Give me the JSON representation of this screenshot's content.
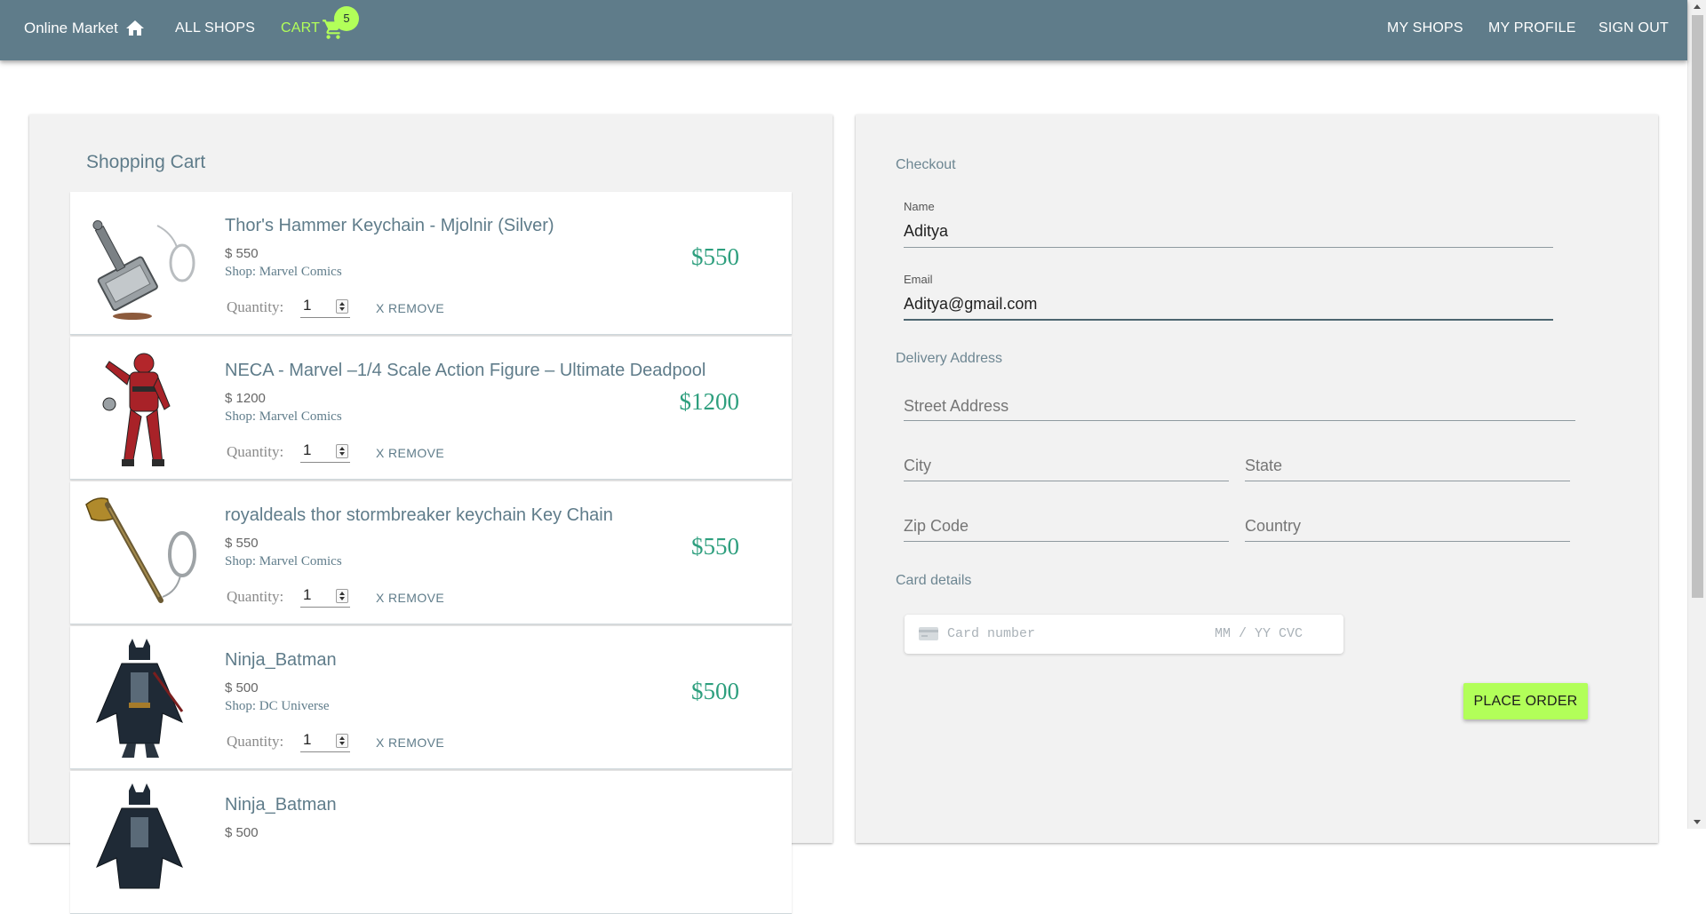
{
  "nav": {
    "brand": "Online Market",
    "all_shops": "ALL SHOPS",
    "cart": "CART",
    "cart_count": "5",
    "my_shops": "MY SHOPS",
    "my_profile": "MY PROFILE",
    "sign_out": "SIGN OUT",
    "icons": [
      "home-icon",
      "shopping-cart-icon"
    ],
    "colors": {
      "appbar": "#5f7c8a",
      "accent": "#b2ff59"
    }
  },
  "cart": {
    "title": "Shopping Cart",
    "quantity_label": "Quantity:",
    "remove_label": "X REMOVE",
    "items": [
      {
        "name": "Thor's Hammer Keychain - Mjolnir (Silver)",
        "unit_price": "$ 550",
        "shop": "Shop: Marvel Comics",
        "quantity": "1",
        "total": "$550",
        "image": "mjolnir-keychain"
      },
      {
        "name": "NECA - Marvel –1/4 Scale Action Figure – Ultimate Deadpool",
        "unit_price": "$ 1200",
        "shop": "Shop: Marvel Comics",
        "quantity": "1",
        "total": "$1200",
        "image": "deadpool-figure"
      },
      {
        "name": "royaldeals thor stormbreaker keychain Key Chain",
        "unit_price": "$ 550",
        "shop": "Shop: Marvel Comics",
        "quantity": "1",
        "total": "$550",
        "image": "stormbreaker-keychain"
      },
      {
        "name": "Ninja_Batman",
        "unit_price": "$ 500",
        "shop": "Shop: DC Universe",
        "quantity": "1",
        "total": "$500",
        "image": "ninja-batman"
      },
      {
        "name": "Ninja_Batman",
        "unit_price": "$ 500",
        "shop": "",
        "quantity": "",
        "total": "",
        "image": "ninja-batman"
      }
    ]
  },
  "checkout": {
    "title": "Checkout",
    "name_label": "Name",
    "name_value": "Aditya",
    "email_label": "Email",
    "email_value": "Aditya@gmail.com",
    "delivery_title": "Delivery Address",
    "street_placeholder": "Street Address",
    "city_placeholder": "City",
    "state_placeholder": "State",
    "zip_placeholder": "Zip Code",
    "country_placeholder": "Country",
    "card_title": "Card details",
    "card_number_placeholder": "Card number",
    "card_exp_placeholder": "MM / YY CVC",
    "place_order": "PLACE ORDER"
  }
}
